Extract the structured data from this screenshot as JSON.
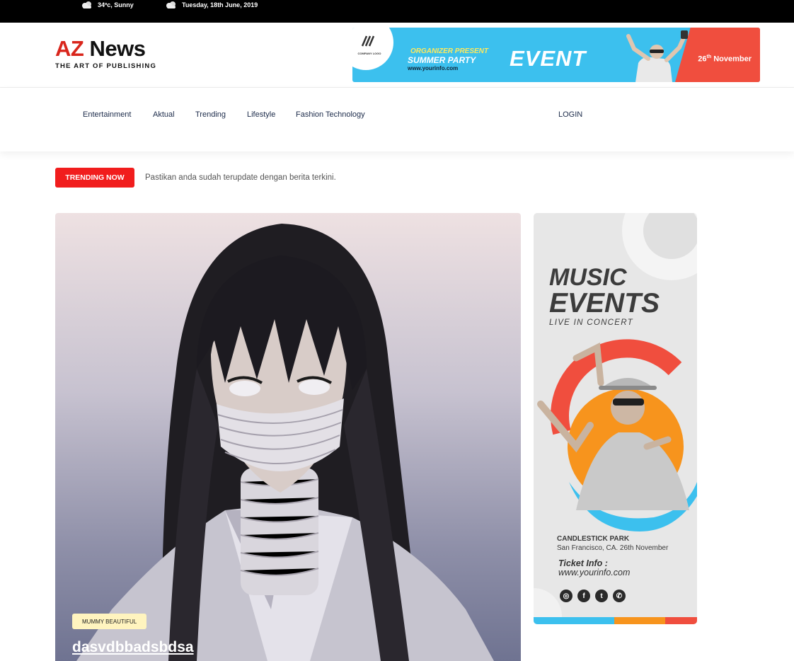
{
  "topbar": {
    "weather": "34ºc, Sunny",
    "date": "Tuesday, 18th June, 2019"
  },
  "logo": {
    "title_a": "AZ",
    "title_b": "News",
    "tagline": "THE ART OF PUBLISHING"
  },
  "header_banner": {
    "company_logo": "COMPANY LOGO",
    "organizer": "ORGANIZER PRESENT",
    "headline": "SUMMER PARTY",
    "url": "www.yourinfo.com",
    "event": "EVENT",
    "date_day": "26",
    "date_suffix": "th",
    "date_month": "November",
    "colors": {
      "bg": "#3cc0ee",
      "accent": "#f04e3e"
    }
  },
  "nav": {
    "items": [
      "Entertainment",
      "Aktual",
      "Trending",
      "Lifestyle",
      "Fashion Technology"
    ],
    "login": "LOGIN"
  },
  "trending": {
    "label": "TRENDING NOW",
    "text": "Pastikan anda sudah terupdate dengan berita terkini."
  },
  "hero": {
    "category": "MUMMY BEAUTIFUL",
    "title": "dasvdbbadsbdsa",
    "image": "anime-girl-bandaged-face"
  },
  "side_ad": {
    "title1": "MUSIC",
    "title2": "EVENTS",
    "subtitle": "LIVE IN CONCERT",
    "venue": "CANDLESTICK PARK",
    "city": "San Francisco, CA. 26th November",
    "ticket_label": "Ticket Info :",
    "ticket_url": "www.yourinfo.com",
    "social": [
      "instagram-icon",
      "facebook-icon",
      "twitter-icon",
      "whatsapp-icon"
    ],
    "stripe_colors": [
      "#3cc0ee",
      "#f7941d",
      "#f04e3e"
    ]
  },
  "colors": {
    "brand_red": "#d9261c",
    "trending_red": "#f11d1d",
    "nav_text": "#1c2b4a"
  }
}
